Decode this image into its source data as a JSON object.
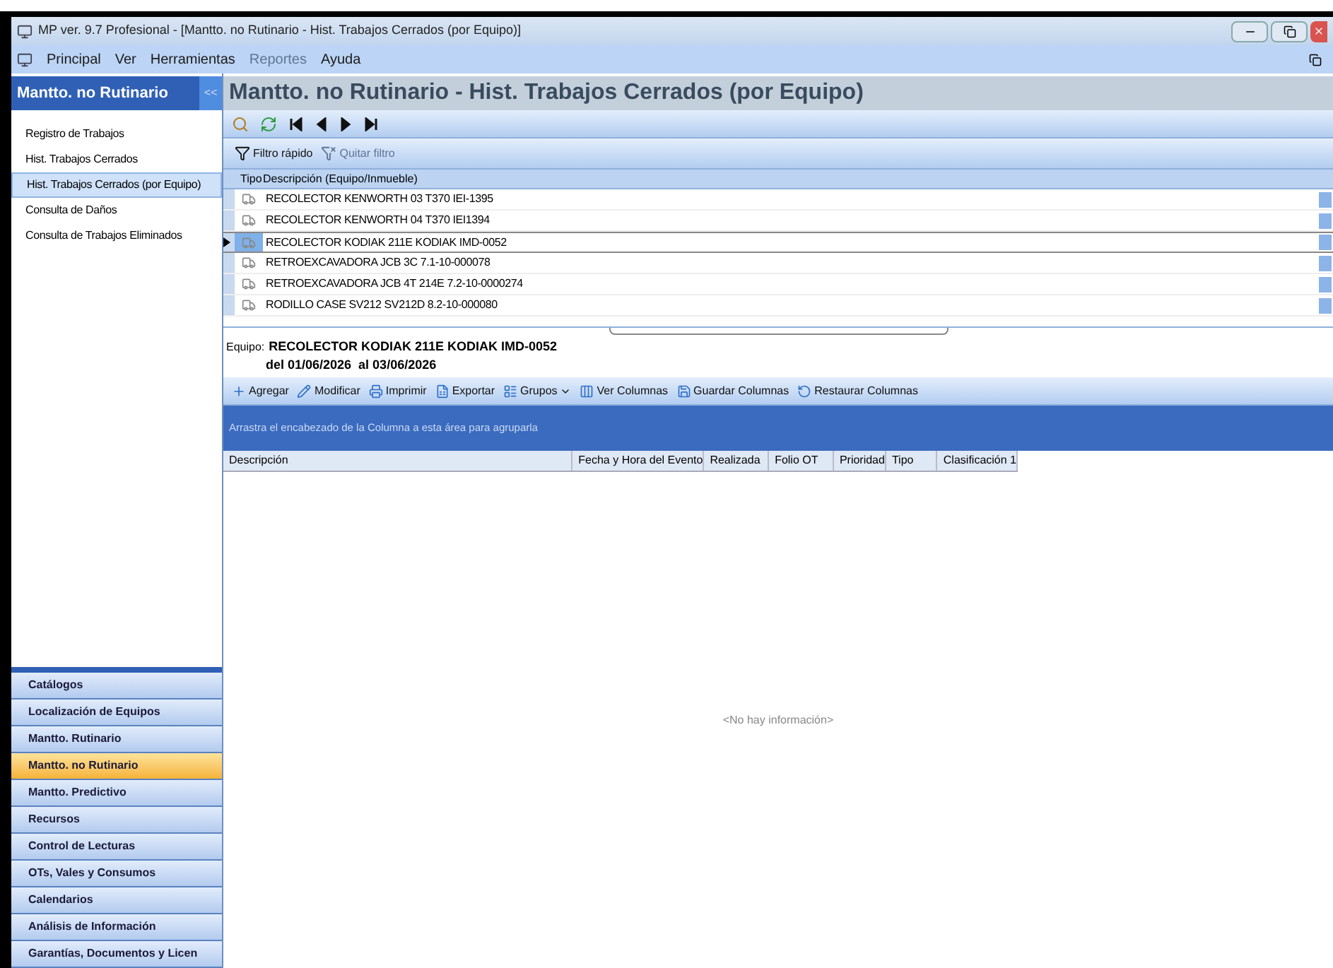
{
  "window": {
    "title": "MP ver. 9.7 Profesional - [Mantto. no Rutinario - Hist. Trabajos Cerrados (por Equipo)]"
  },
  "menu": [
    {
      "label": "Principal",
      "disabled": false
    },
    {
      "label": "Ver",
      "disabled": false
    },
    {
      "label": "Herramientas",
      "disabled": false
    },
    {
      "label": "Reportes",
      "disabled": true
    },
    {
      "label": "Ayuda",
      "disabled": false
    }
  ],
  "sidebar": {
    "title": "Mantto. no Rutinario",
    "collapse": "<<",
    "items": [
      {
        "label": "Registro de Trabajos",
        "selected": false
      },
      {
        "label": "Hist. Trabajos Cerrados",
        "selected": false
      },
      {
        "label": "Hist. Trabajos Cerrados (por Equipo)",
        "selected": true
      },
      {
        "label": "Consulta de Daños",
        "selected": false
      },
      {
        "label": "Consulta de Trabajos Eliminados",
        "selected": false
      }
    ],
    "modules": [
      {
        "label": "Catálogos",
        "selected": false
      },
      {
        "label": "Localización de Equipos",
        "selected": false
      },
      {
        "label": "Mantto. Rutinario",
        "selected": false
      },
      {
        "label": "Mantto. no Rutinario",
        "selected": true
      },
      {
        "label": "Mantto. Predictivo",
        "selected": false
      },
      {
        "label": "Recursos",
        "selected": false
      },
      {
        "label": "Control de Lecturas",
        "selected": false
      },
      {
        "label": "OTs, Vales y Consumos",
        "selected": false
      },
      {
        "label": "Calendarios",
        "selected": false
      },
      {
        "label": "Análisis de Información",
        "selected": false
      },
      {
        "label": "Garantías, Documentos y Licen",
        "selected": false
      }
    ]
  },
  "heading": "Mantto. no Rutinario - Hist. Trabajos Cerrados (por Equipo)",
  "filter_toolbar": [
    {
      "label": "Filtro rápido",
      "disabled": false
    },
    {
      "label": "Quitar filtro",
      "disabled": true
    }
  ],
  "equipment_grid": {
    "columns": [
      "Tipo",
      "Descripción (Equipo/Inmueble)"
    ],
    "rows": [
      {
        "description": "RECOLECTOR KENWORTH 03 T370 IEI-1395",
        "selected": false
      },
      {
        "description": "RECOLECTOR KENWORTH 04 T370 IEI1394",
        "selected": false
      },
      {
        "description": "RECOLECTOR KODIAK 211E KODIAK IMD-0052",
        "selected": true
      },
      {
        "description": "RETROEXCAVADORA JCB 3C 7.1-10-000078",
        "selected": false
      },
      {
        "description": "RETROEXCAVADORA JCB 4T 214E 7.2-10-0000274",
        "selected": false
      },
      {
        "description": "RODILLO CASE SV212 SV212D 8.2-10-000080",
        "selected": false
      }
    ]
  },
  "detail": {
    "label": "Equipo:",
    "equipment": "RECOLECTOR KODIAK 211E KODIAK IMD-0052",
    "range": "del 01/06/2026  al 03/06/2026"
  },
  "actions": [
    {
      "kind": "add",
      "label": "Agregar"
    },
    {
      "kind": "edit",
      "label": "Modificar"
    },
    {
      "kind": "print",
      "label": "Imprimir"
    },
    {
      "kind": "export",
      "label": "Exportar"
    },
    {
      "kind": "groups",
      "label": "Grupos"
    },
    {
      "kind": "columns",
      "label": "Ver Columnas"
    },
    {
      "kind": "save",
      "label": "Guardar Columnas"
    },
    {
      "kind": "restore",
      "label": "Restaurar Columnas"
    }
  ],
  "group_panel": "Arrastra el encabezado de la Columna a esta área para agruparla",
  "events_grid": {
    "columns": [
      "Descripción",
      "Fecha y Hora del Evento",
      "Realizada",
      "Folio OT",
      "Prioridad",
      "Tipo",
      "Clasificación 1"
    ],
    "empty": "<No hay información>"
  }
}
